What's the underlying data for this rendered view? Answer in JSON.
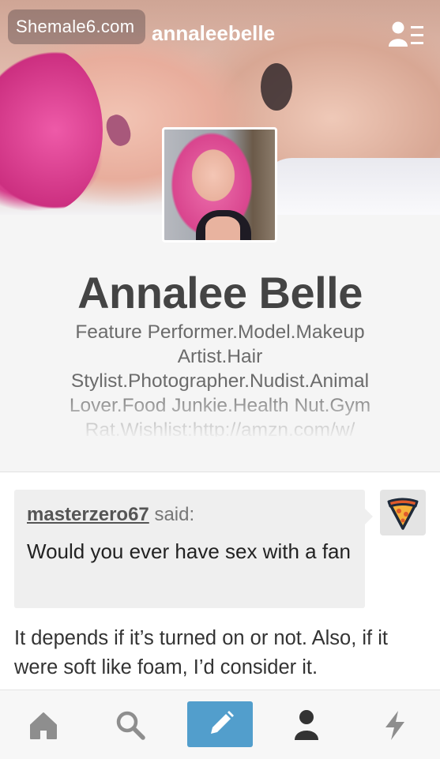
{
  "header": {
    "watermark": "Shemale6.com",
    "username": "annaleebelle",
    "menu_icon": "user-list-icon"
  },
  "profile": {
    "display_name": "Annalee Belle",
    "bio": "Feature Performer.Model.Makeup Artist.Hair Stylist.Photographer.Nudist.Animal Lover.Food Junkie.Health Nut.Gym Rat.Wishlist:http://amzn.com/w/"
  },
  "post": {
    "asker": "masterzero67",
    "said_label": "said:",
    "question": "Would you ever have sex with a fan",
    "answer": "It depends if it’s turned on or not. Also, if it were soft like foam, I’d consider it."
  },
  "tabbar": {
    "items": [
      "home-icon",
      "search-icon",
      "compose-icon",
      "account-icon",
      "activity-icon"
    ],
    "accent": "#529ecc"
  }
}
